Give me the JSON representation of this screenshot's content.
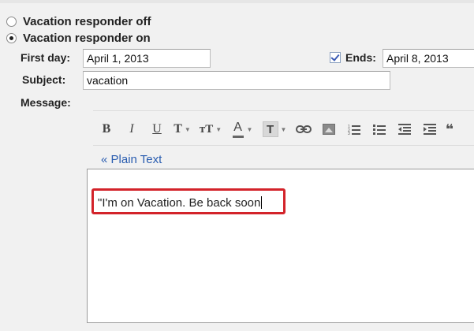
{
  "responder": {
    "off_label": "Vacation responder off",
    "on_label": "Vacation responder on"
  },
  "fields": {
    "first_day_label": "First day:",
    "first_day_value": "April 1, 2013",
    "ends_label": "Ends:",
    "ends_value": "April 8, 2013",
    "subject_label": "Subject:",
    "subject_value": "vacation",
    "message_label": "Message:"
  },
  "toolbar": {
    "bold": "B",
    "italic": "I",
    "underline": "U",
    "font": "T",
    "size": "тT",
    "text_color": "A",
    "bg_color": "T",
    "link": "⊂⊃"
  },
  "editor": {
    "plain_text_link": "« Plain Text",
    "message_text": "\"I'm on Vacation. Be back soon"
  },
  "colors": {
    "link": "#2a5db0",
    "highlight": "#d3232a"
  }
}
